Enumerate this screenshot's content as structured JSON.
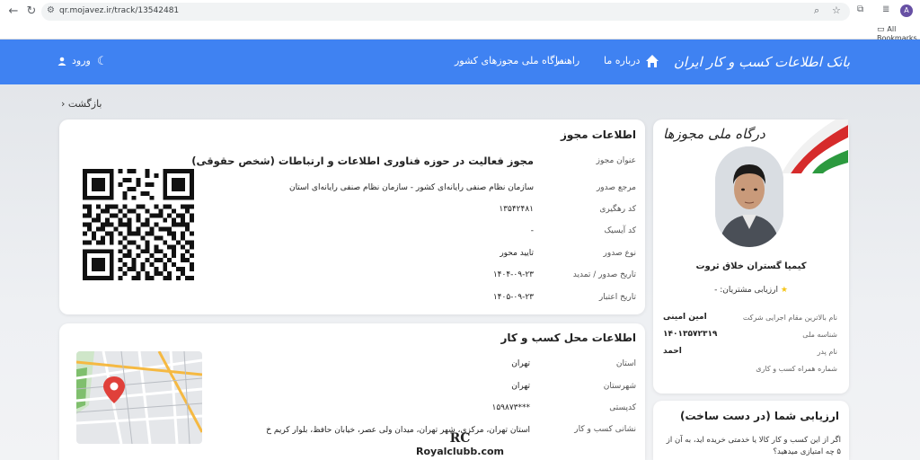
{
  "browser": {
    "url": "qr.mojavez.ir/track/13542481",
    "bookmarks_folder": "All Bookmarks",
    "profile_initial": "A"
  },
  "header": {
    "brand": "بانک اطلاعات کسب و کار ایران",
    "nav": [
      "درباره ما",
      "راهنما",
      "درگاه ملی مجوزهای کشور"
    ],
    "login": "ورود"
  },
  "back_label": "بازگشت",
  "license": {
    "title": "اطلاعات مجوز",
    "rows": [
      {
        "label": "عنوان مجوز",
        "value": "مجوز فعالیت در حوزه فناوری اطلاعات و ارتباطات (شخص حقوقی)"
      },
      {
        "label": "مرجع صدور",
        "value": "سازمان نظام صنفی رایانه‌ای کشور - سازمان نظام صنفی رایانه‌ای استان"
      },
      {
        "label": "کد رهگیری",
        "value": "۱۳۵۴۲۴۸۱"
      },
      {
        "label": "کد آیسیک",
        "value": "-"
      },
      {
        "label": "نوع صدور",
        "value": "تایید محور"
      },
      {
        "label": "تاریخ صدور / تمدید",
        "value": "۱۴۰۴-۰۹-۲۳"
      },
      {
        "label": "تاریخ اعتبار",
        "value": "۱۴۰۵-۰۹-۲۳"
      }
    ]
  },
  "location": {
    "title": "اطلاعات محل کسب و کار",
    "rows": [
      {
        "label": "استان",
        "value": "تهران"
      },
      {
        "label": "شهرستان",
        "value": "تهران"
      },
      {
        "label": "کدپستی",
        "value": "***۱۵۹۸۷۳"
      },
      {
        "label": "نشانی کسب و کار",
        "value": "استان تهران، مرکزی، شهر تهران، میدان ولی عصر، خیابان حافظ، بلوار کریم خ"
      }
    ]
  },
  "profile": {
    "badge": "درگاه ملی مجوزها",
    "name": "کیمیا گستران خلاق ثروت",
    "rating": "ارزیابی مشتریان: -",
    "rows": [
      {
        "label": "نام بالاترین مقام اجرایی شرکت",
        "value": "امین امینی"
      },
      {
        "label": "شناسه ملی",
        "value": "۱۴۰۱۳۵۷۲۳۱۹"
      },
      {
        "label": "نام پدر",
        "value": "احمد"
      },
      {
        "label": "شماره همراه کسب و کاری",
        "value": ""
      }
    ]
  },
  "evaluation": {
    "title": "ارزیابی شما (در دست ساخت)",
    "question": "اگر از این کسب و کار کالا یا خدمتی خریده اید، به آن از ۵ چه امتیازی میدهید؟"
  },
  "watermark": {
    "logo": "RC",
    "text": "Royalclubb.com"
  },
  "colors": {
    "header": "#3f82f2",
    "star": "#f5c518"
  }
}
